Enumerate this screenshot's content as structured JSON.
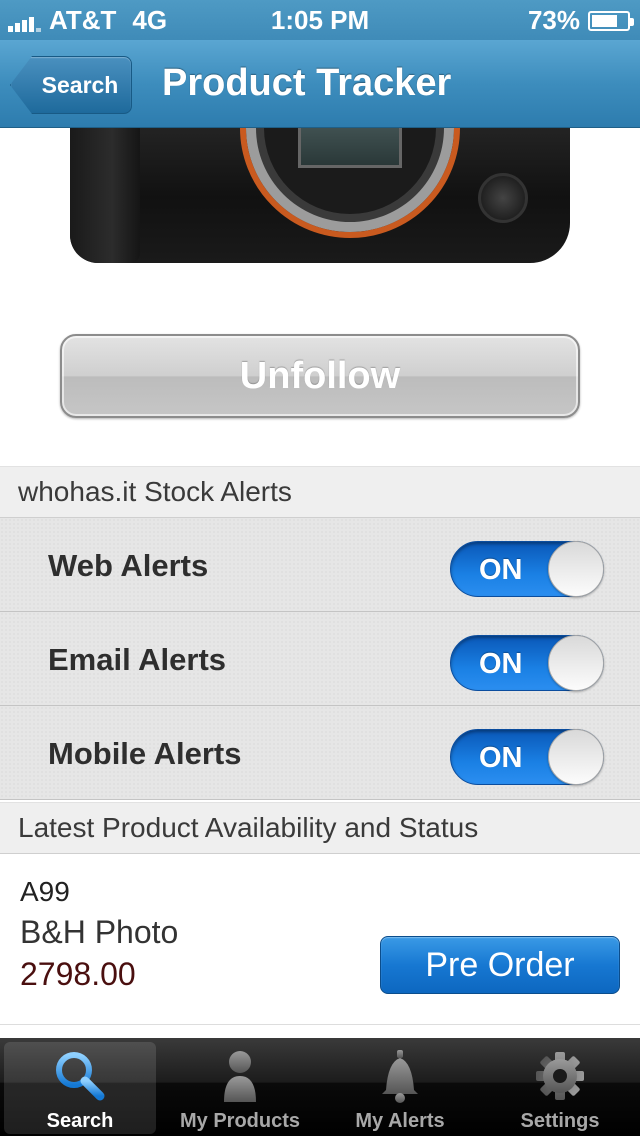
{
  "status_bar": {
    "carrier": "AT&T",
    "network": "4G",
    "time": "1:05 PM",
    "battery": "73%",
    "battery_level": 0.73
  },
  "nav": {
    "back_label": "Search",
    "title": "Product Tracker"
  },
  "product": {
    "image": "camera-body-image",
    "unfollow_label": "Unfollow"
  },
  "stock_alerts": {
    "header": "whohas.it Stock Alerts",
    "items": [
      {
        "label": "Web Alerts",
        "state": "ON"
      },
      {
        "label": "Email Alerts",
        "state": "ON"
      },
      {
        "label": "Mobile Alerts",
        "state": "ON"
      }
    ]
  },
  "availability": {
    "header": "Latest Product Availability and Status",
    "items": [
      {
        "name": "A99",
        "store": "B&H Photo",
        "price": "2798.00",
        "action": "Pre Order"
      }
    ]
  },
  "tab_bar": {
    "tabs": [
      {
        "label": "Search",
        "icon": "search-icon",
        "active": true
      },
      {
        "label": "My Products",
        "icon": "person-icon",
        "active": false
      },
      {
        "label": "My Alerts",
        "icon": "bell-icon",
        "active": false
      },
      {
        "label": "Settings",
        "icon": "gear-icon",
        "active": false
      }
    ]
  },
  "colors": {
    "nav_blue": "#3d8dbd",
    "toggle_blue": "#1a80e4",
    "price_red": "#4a0f0f"
  }
}
